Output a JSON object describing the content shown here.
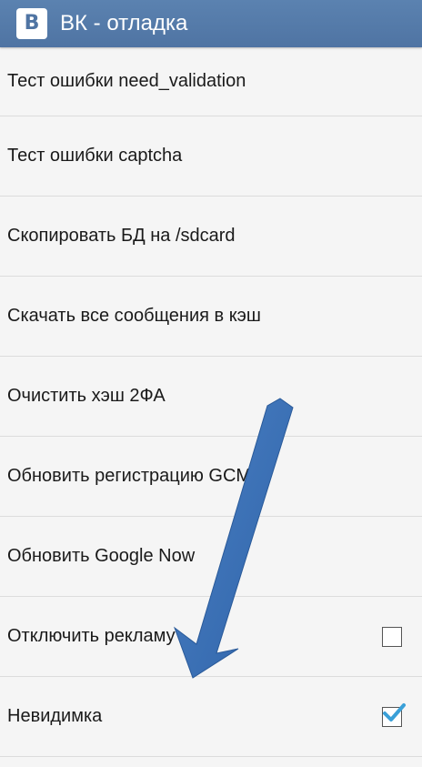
{
  "app_bar": {
    "icon_letter": "B",
    "title": "ВК - отладка",
    "color": "#5279a8"
  },
  "list": {
    "items": [
      {
        "label": "Тест ошибки need_validation"
      },
      {
        "label": "Тест ошибки captcha"
      },
      {
        "label": "Скопировать БД на /sdcard"
      },
      {
        "label": "Скачать все сообщения в кэш"
      },
      {
        "label": "Очистить хэш 2ФА"
      },
      {
        "label": "Обновить регистрацию GCM"
      },
      {
        "label": "Обновить Google Now"
      },
      {
        "label": "Отключить рекламу",
        "checkbox": true,
        "checked": false
      },
      {
        "label": "Невидимка",
        "checkbox": true,
        "checked": true
      }
    ]
  },
  "annotation": {
    "arrow_color": "#3a6fb5",
    "arrow_direction": "down-left"
  },
  "check_color": "#3aa0d8"
}
